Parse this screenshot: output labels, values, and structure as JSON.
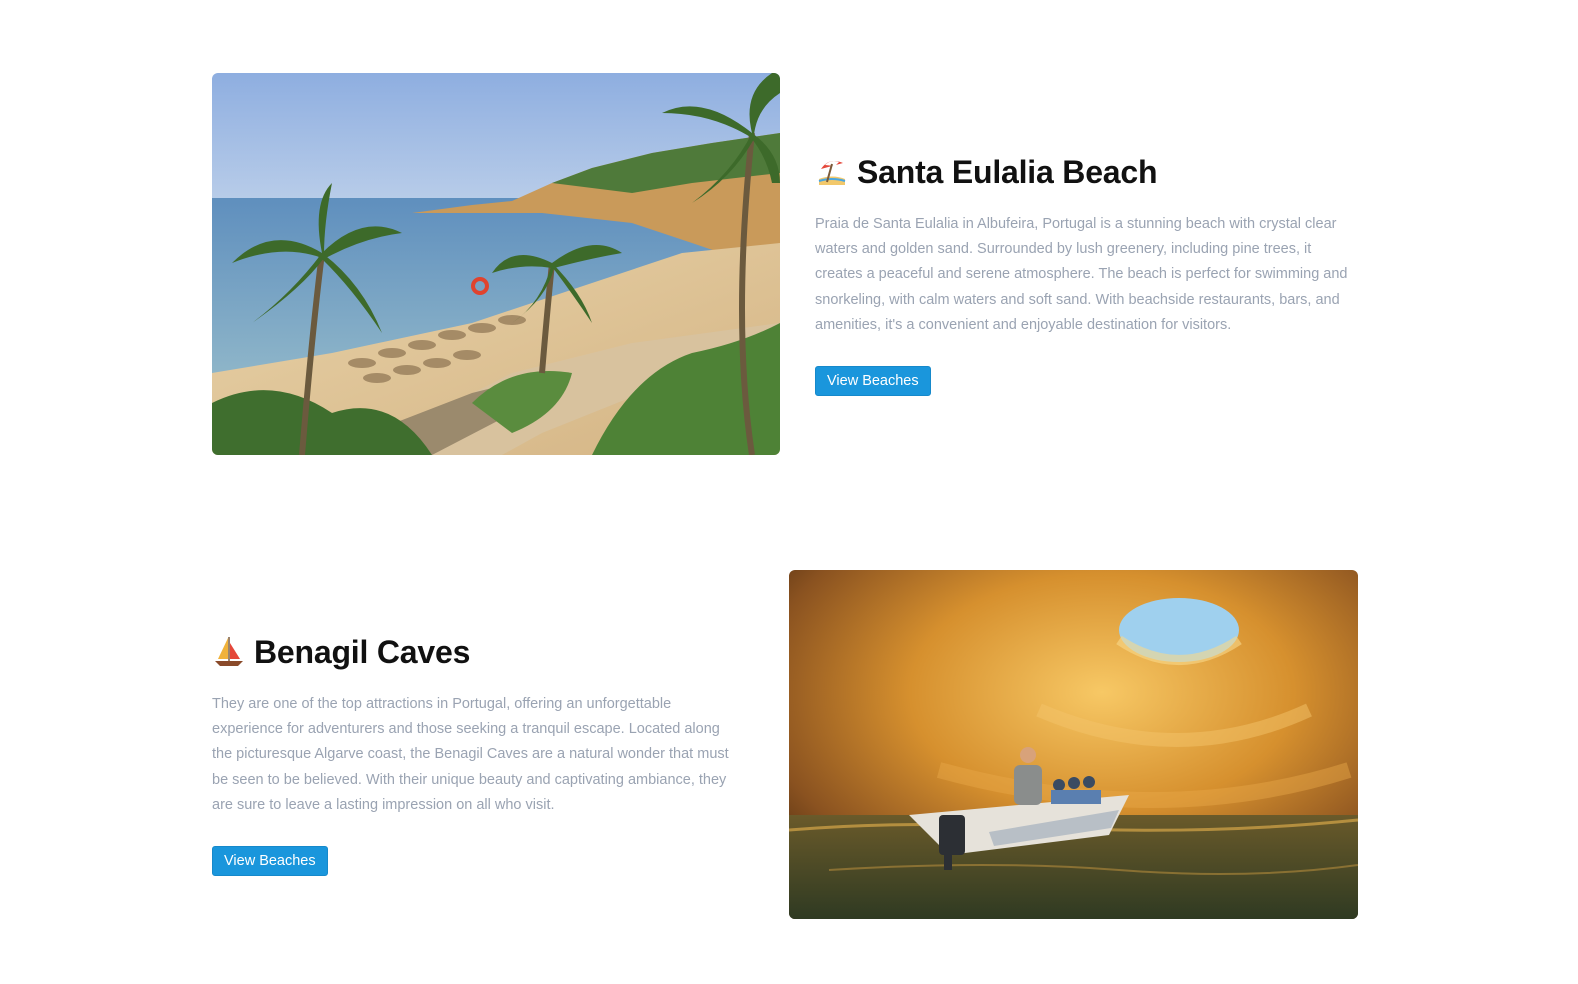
{
  "sections": [
    {
      "title": "Santa Eulalia Beach",
      "emoji_icon": "beach-umbrella-icon",
      "description": "Praia de Santa Eulalia in Albufeira, Portugal is a stunning beach with crystal clear waters and golden sand. Surrounded by lush greenery, including pine trees, it creates a peaceful and serene atmosphere. The beach is perfect for swimming and snorkeling, with calm waters and soft sand. With beachside restaurants, bars, and amenities, it's a convenient and enjoyable destination for visitors.",
      "button_label": "View Beaches",
      "image_alt": "Santa Eulalia beach with palm trees"
    },
    {
      "title": "Benagil Caves",
      "emoji_icon": "sailboat-icon",
      "description": "They are one of the top attractions in Portugal, offering an unforgettable experience for adventurers and those seeking a tranquil escape. Located along the picturesque Algarve coast, the Benagil Caves are a natural wonder that must be seen to be believed. With their unique beauty and captivating ambiance, they are sure to leave a lasting impression on all who visit.",
      "button_label": "View Beaches",
      "image_alt": "Boat inside Benagil sea cave"
    }
  ],
  "colors": {
    "button_bg": "#1a96dc",
    "description_text": "#9aa3b2",
    "title_text": "#111111"
  }
}
